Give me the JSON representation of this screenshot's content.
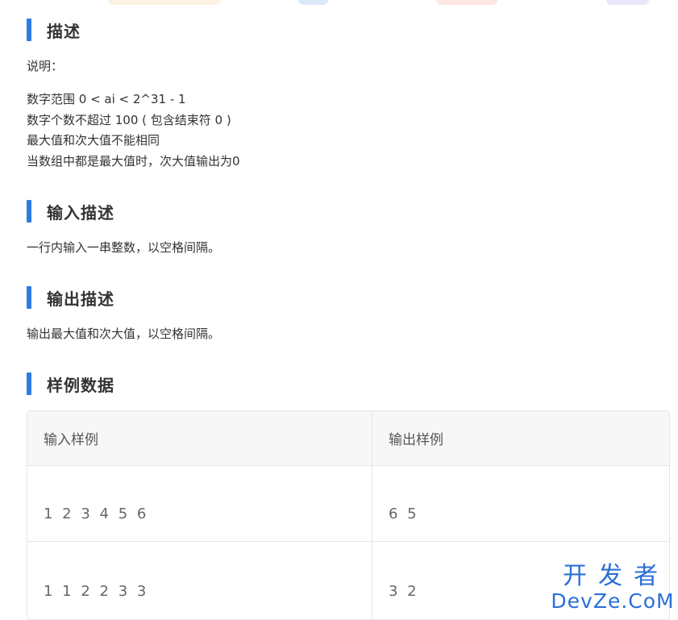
{
  "sections": {
    "description": {
      "title": "描述",
      "intro": "说明：",
      "lines": [
        "数字范围 0 < ai < 2^31 - 1",
        "数字个数不超过 100 ( 包含结束符 0 )",
        "最大值和次大值不能相同",
        "当数组中都是最大值时，次大值输出为0"
      ]
    },
    "input": {
      "title": "输入描述",
      "text": "一行内输入一串整数，以空格间隔。"
    },
    "output": {
      "title": "输出描述",
      "text": "输出最大值和次大值，以空格间隔。"
    },
    "samples": {
      "title": "样例数据",
      "headers": [
        "输入样例",
        "输出样例"
      ],
      "rows": [
        [
          "1 2 3 4 5 6",
          "6 5"
        ],
        [
          "1 1 2 2 3 3",
          "3 2"
        ]
      ]
    }
  },
  "watermark": {
    "top": "开发者",
    "bottom": "DevZe.CoM"
  },
  "colors": {
    "accent": "#2d7be5",
    "text": "#333333",
    "table_header_bg": "#f7f7f7",
    "border": "#e6e6e6",
    "watermark": "#2a6fd8"
  }
}
